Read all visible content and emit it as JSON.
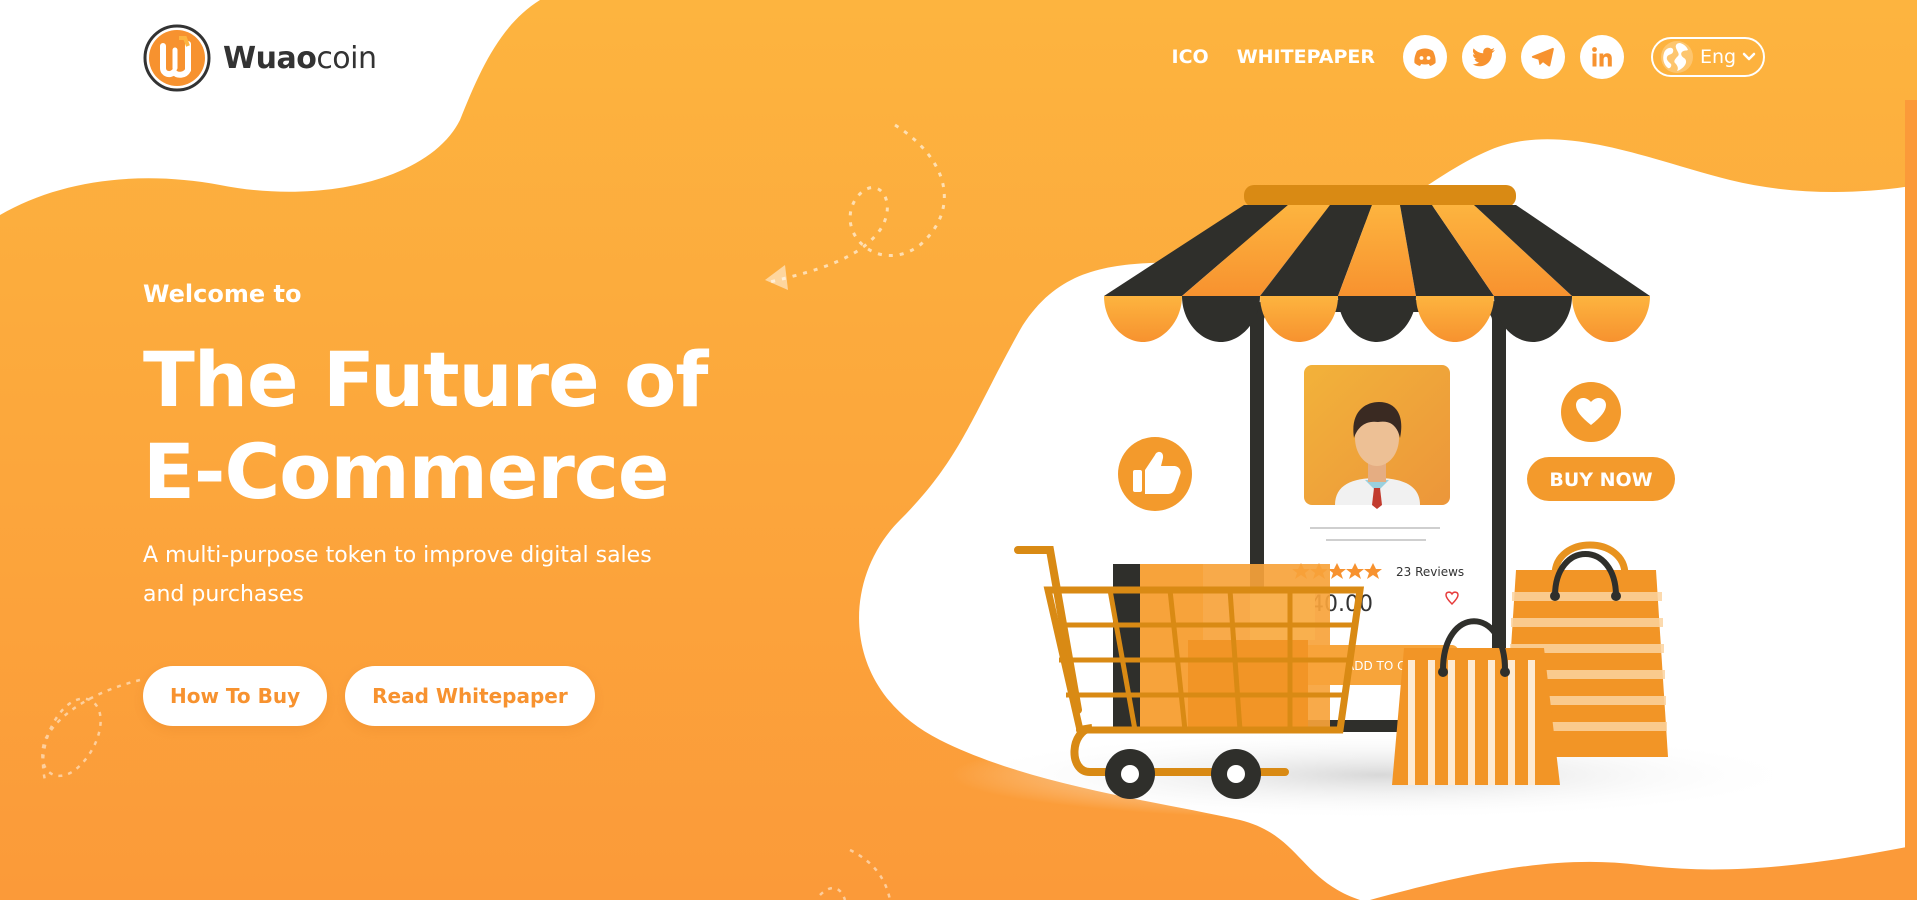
{
  "brand": {
    "name_bold": "Wuao",
    "name_light": "coin",
    "logo_letter": "w"
  },
  "nav": {
    "links": [
      "ICO",
      "WHITEPAPER"
    ],
    "social": [
      "discord-icon",
      "twitter-icon",
      "telegram-icon",
      "linkedin-icon"
    ],
    "language": "Eng"
  },
  "hero": {
    "welcome": "Welcome to",
    "title_line1": "The Future of",
    "title_line2": "E-Commerce",
    "subtitle": "A multi-purpose token to improve digital sales and purchases",
    "buttons": [
      "How To Buy",
      "Read Whitepaper"
    ]
  },
  "illustration": {
    "reviews": "23 Reviews",
    "rating_stars": 5,
    "price": "40.00",
    "add_to_cart": "ADD TO CART",
    "buy_now": "BUY NOW"
  },
  "colors": {
    "primary": "#f7922f",
    "light": "#fdb43f",
    "dark": "#2f2f2b",
    "text_dark": "#333333"
  }
}
